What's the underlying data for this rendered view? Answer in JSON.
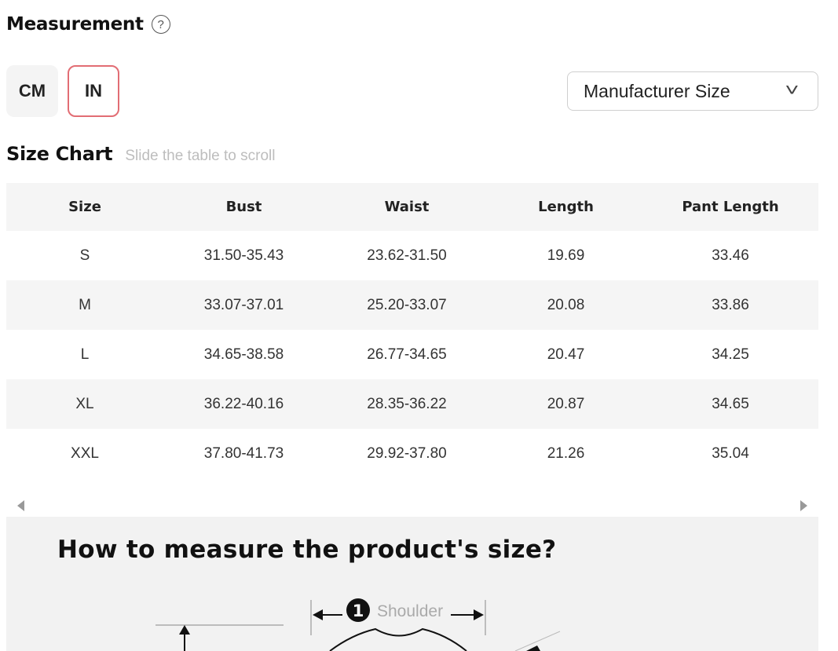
{
  "measurement": {
    "title": "Measurement",
    "help_glyph": "?"
  },
  "units": {
    "cm_label": "CM",
    "in_label": "IN",
    "selected": "IN",
    "active_color": "#e26d74"
  },
  "size_type": {
    "selected": "Manufacturer Size",
    "chevron_glyph": "˅"
  },
  "size_chart": {
    "title": "Size Chart",
    "hint": "Slide the table to scroll",
    "columns": [
      "Size",
      "Bust",
      "Waist",
      "Length",
      "Pant Length"
    ],
    "rows": [
      [
        "S",
        "31.50-35.43",
        "23.62-31.50",
        "19.69",
        "33.46"
      ],
      [
        "M",
        "33.07-37.01",
        "25.20-33.07",
        "20.08",
        "33.86"
      ],
      [
        "L",
        "34.65-38.58",
        "26.77-34.65",
        "20.47",
        "34.25"
      ],
      [
        "XL",
        "36.22-40.16",
        "28.35-36.22",
        "20.87",
        "34.65"
      ],
      [
        "XXL",
        "37.80-41.73",
        "29.92-37.80",
        "21.26",
        "35.04"
      ]
    ]
  },
  "how_to_measure": {
    "title": "How to measure the product's size?",
    "step_number": "1",
    "step_label": "Shoulder"
  }
}
